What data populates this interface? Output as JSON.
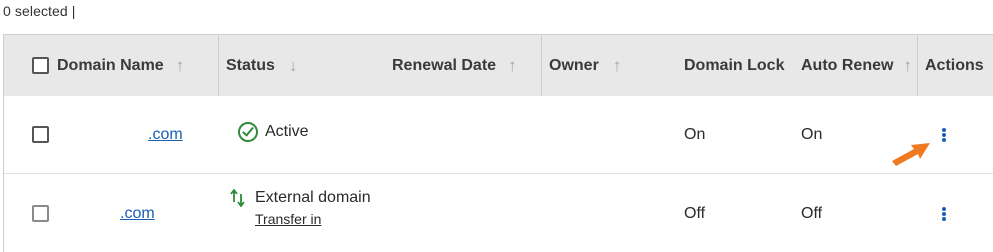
{
  "selection": {
    "summary": "0 selected |"
  },
  "columns": {
    "domain_name": "Domain Name",
    "status": "Status",
    "renewal_date": "Renewal Date",
    "owner": "Owner",
    "domain_lock": "Domain Lock",
    "auto_renew": "Auto Renew",
    "actions": "Actions"
  },
  "icons": {
    "sort": "arrow-up-icon",
    "sort_status": "arrow-down-icon",
    "status_active": "check-circle-icon",
    "status_transfer": "transfer-arrows-icon",
    "actions": "kebab-menu-icon",
    "pointer": "arrow-pointer-icon"
  },
  "colors": {
    "link": "#1a5fb4",
    "active": "#2e8b3a",
    "off": "#d9534f",
    "header_bg": "#e8e8e8",
    "pointer": "#f07a22"
  },
  "rows": [
    {
      "domain": ".com",
      "status": "Active",
      "status_sub": "",
      "renewal_date": "",
      "owner": "",
      "domain_lock": "On",
      "auto_renew": "On"
    },
    {
      "domain": ".com",
      "status": "External domain",
      "status_sub": "Transfer in",
      "renewal_date": "",
      "owner": "",
      "domain_lock": "Off",
      "auto_renew": "Off"
    }
  ]
}
